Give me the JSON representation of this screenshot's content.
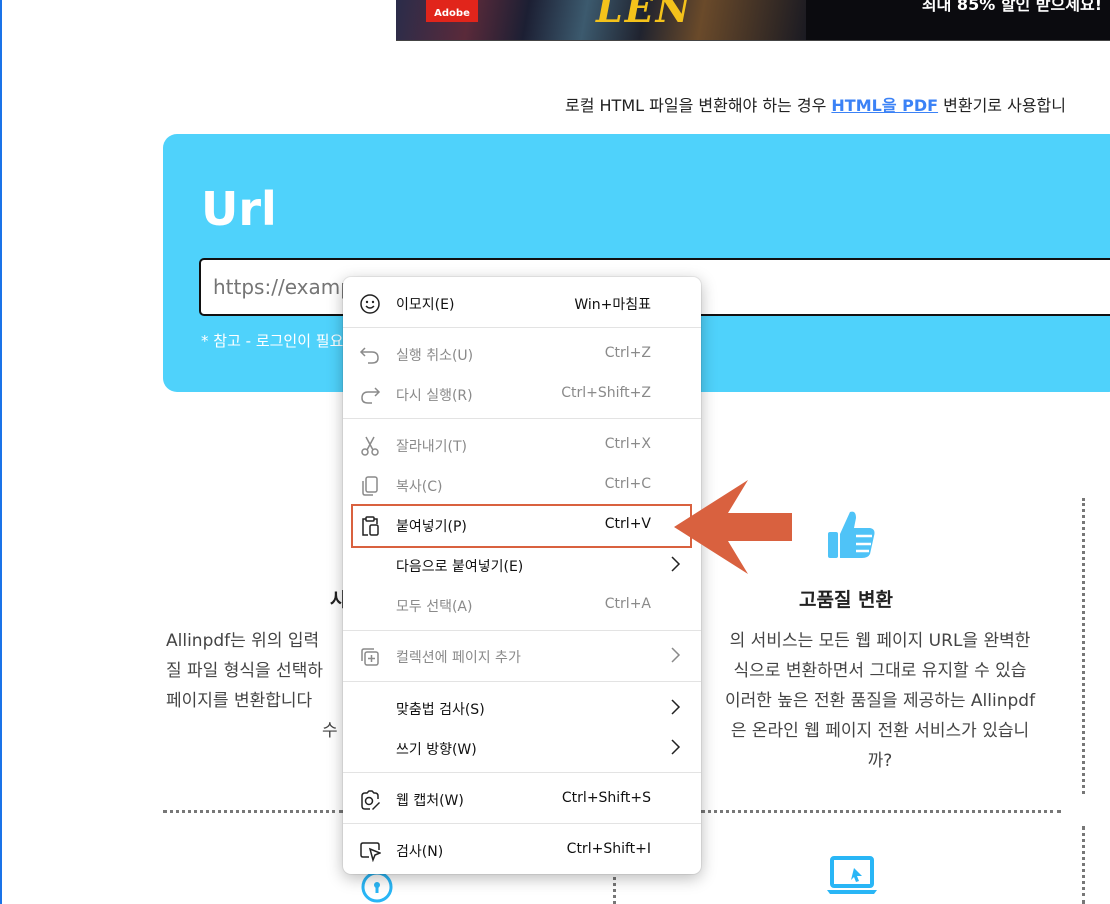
{
  "banner": {
    "brand": "Adobe",
    "script_text": "LEN",
    "promo_text": "최대 85% 할인 받으세요!"
  },
  "notice": {
    "prefix": "로컬 HTML 파일을 변환해야 하는 경우 ",
    "link": "HTML을 PDF",
    "suffix": " 변환기로 사용합니"
  },
  "url_card": {
    "title": "Url",
    "input_placeholder": "https://example.com",
    "note": "* 참고 - 로그인이 필요한 웹 페이지는 변환할 수 없습니다."
  },
  "features": {
    "left": {
      "title": "사",
      "lines": [
        "Allinpdf는 위의 입력",
        "질 파일 형식을 선택하",
        "페이지를 변환합니다",
        "수"
      ]
    },
    "right": {
      "title": "고품질 변환",
      "lines": [
        "의 서비스는 모든 웹 페이지 URL을 완벽한",
        "식으로 변환하면서 그대로 유지할 수 있습",
        "이러한 높은 전환 품질을 제공하는 Allinpdf",
        "은 온라인 웹 페이지 전환 서비스가 있습니",
        "까?"
      ]
    }
  },
  "context_menu": {
    "items": [
      {
        "label": "이모지(E)",
        "shortcut": "Win+마침표",
        "icon": "emoji-icon",
        "enabled": true
      },
      {
        "label": "실행 취소(U)",
        "shortcut": "Ctrl+Z",
        "icon": "undo-icon",
        "enabled": false
      },
      {
        "label": "다시 실행(R)",
        "shortcut": "Ctrl+Shift+Z",
        "icon": "redo-icon",
        "enabled": false
      },
      {
        "label": "잘라내기(T)",
        "shortcut": "Ctrl+X",
        "icon": "scissors-icon",
        "enabled": false
      },
      {
        "label": "복사(C)",
        "shortcut": "Ctrl+C",
        "icon": "copy-icon",
        "enabled": false
      },
      {
        "label": "붙여넣기(P)",
        "shortcut": "Ctrl+V",
        "icon": "paste-icon",
        "enabled": true
      },
      {
        "label": "다음으로 붙여넣기(E)",
        "shortcut": "",
        "icon": "",
        "enabled": true
      },
      {
        "label": "모두 선택(A)",
        "shortcut": "Ctrl+A",
        "icon": "",
        "enabled": false
      },
      {
        "label": "컬렉션에 페이지 추가",
        "shortcut": "",
        "icon": "collections-icon",
        "enabled": false
      },
      {
        "label": "맞춤법 검사(S)",
        "shortcut": "",
        "icon": "",
        "enabled": true
      },
      {
        "label": "쓰기 방향(W)",
        "shortcut": "",
        "icon": "",
        "enabled": true
      },
      {
        "label": "웹 캡처(W)",
        "shortcut": "Ctrl+Shift+S",
        "icon": "web-capture-icon",
        "enabled": true
      },
      {
        "label": "검사(N)",
        "shortcut": "Ctrl+Shift+I",
        "icon": "inspect-icon",
        "enabled": true
      }
    ]
  },
  "colors": {
    "card_bg": "#4fd2fb",
    "highlight": "#d9613f",
    "link": "#3b82f6"
  }
}
